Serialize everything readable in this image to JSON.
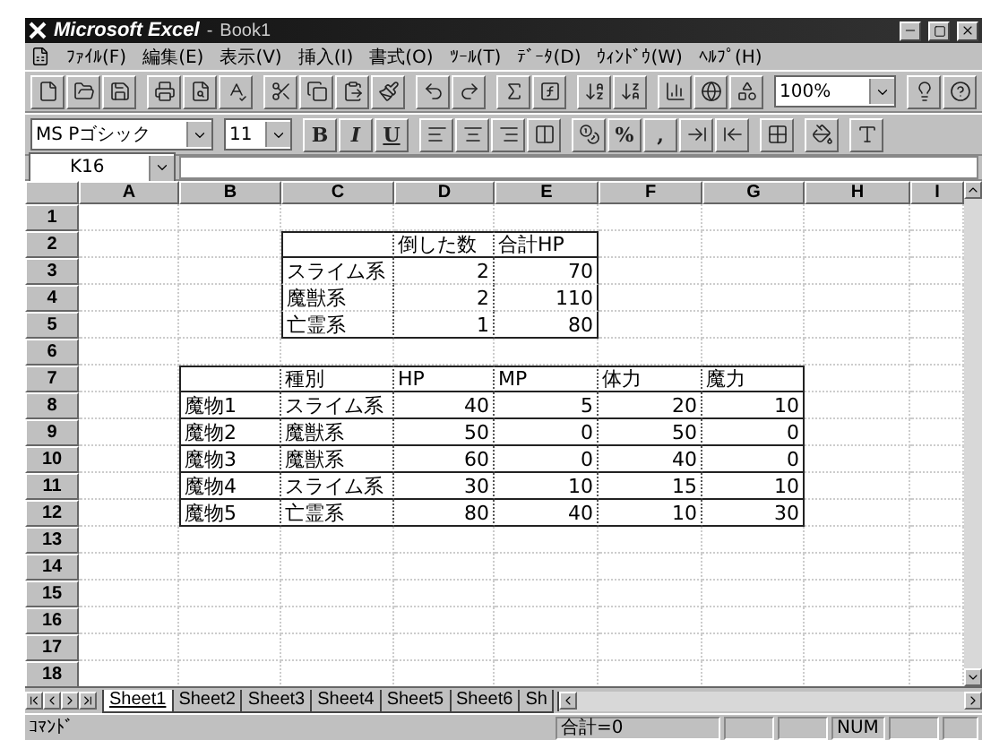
{
  "window": {
    "app_name": "Microsoft Excel",
    "separator": "-",
    "document": "Book1"
  },
  "menu": [
    "ﾌｧｲﾙ(F)",
    "編集(E)",
    "表示(V)",
    "挿入(I)",
    "書式(O)",
    "ﾂｰﾙ(T)",
    "ﾃﾞｰﾀ(D)",
    "ｳｨﾝﾄﾞｳ(W)",
    "ﾍﾙﾌﾟ(H)"
  ],
  "zoom": "100%",
  "font_name": "MS Pゴシック",
  "font_size": "11",
  "style_buttons": [
    "B",
    "I",
    "U"
  ],
  "number_buttons": [
    "%",
    ","
  ],
  "name_box": "K16",
  "columns": [
    "A",
    "B",
    "C",
    "D",
    "E",
    "F",
    "G",
    "H",
    "I"
  ],
  "rows": [
    {
      "number": "1"
    },
    {
      "number": "2",
      "cells": {
        "D": "倒した数",
        "E": "合計HP"
      }
    },
    {
      "number": "3",
      "cells": {
        "C": "スライム系",
        "D": "2",
        "E": "70"
      }
    },
    {
      "number": "4",
      "cells": {
        "C": "魔獣系",
        "D": "2",
        "E": "110"
      }
    },
    {
      "number": "5",
      "cells": {
        "C": "亡霊系",
        "D": "1",
        "E": "80"
      }
    },
    {
      "number": "6"
    },
    {
      "number": "7",
      "cells": {
        "C": "種別",
        "D": "HP",
        "E": "MP",
        "F": "体力",
        "G": "魔力"
      }
    },
    {
      "number": "8",
      "cells": {
        "B": "魔物1",
        "C": "スライム系",
        "D": "40",
        "E": "5",
        "F": "20",
        "G": "10"
      }
    },
    {
      "number": "9",
      "cells": {
        "B": "魔物2",
        "C": "魔獣系",
        "D": "50",
        "E": "0",
        "F": "50",
        "G": "0"
      }
    },
    {
      "number": "10",
      "cells": {
        "B": "魔物3",
        "C": "魔獣系",
        "D": "60",
        "E": "0",
        "F": "40",
        "G": "0"
      }
    },
    {
      "number": "11",
      "cells": {
        "B": "魔物4",
        "C": "スライム系",
        "D": "30",
        "E": "10",
        "F": "15",
        "G": "10"
      }
    },
    {
      "number": "12",
      "cells": {
        "B": "魔物5",
        "C": "亡霊系",
        "D": "80",
        "E": "40",
        "F": "10",
        "G": "30"
      }
    },
    {
      "number": "13"
    },
    {
      "number": "14"
    },
    {
      "number": "15"
    },
    {
      "number": "16"
    },
    {
      "number": "17"
    },
    {
      "number": "18"
    }
  ],
  "sheet_tabs": [
    {
      "label": "Sheet1",
      "selected": true
    },
    {
      "label": "Sheet2",
      "selected": false
    },
    {
      "label": "Sheet3",
      "selected": false
    },
    {
      "label": "Sheet4",
      "selected": false
    },
    {
      "label": "Sheet5",
      "selected": false
    },
    {
      "label": "Sheet6",
      "selected": false
    },
    {
      "label": "Sh",
      "selected": false
    }
  ],
  "status": {
    "mode": "ｺﾏﾝﾄﾞ",
    "sum": "合計=0",
    "num": "NUM"
  }
}
